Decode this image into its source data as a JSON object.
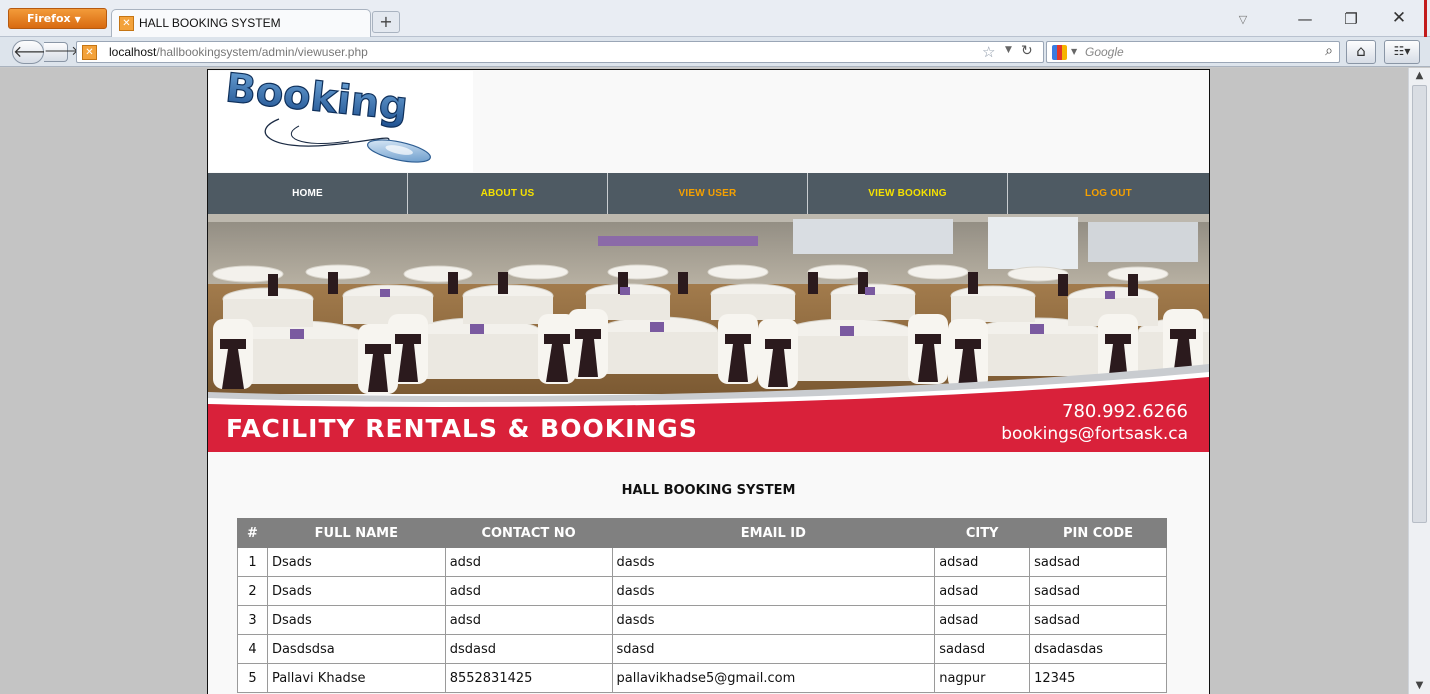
{
  "browser": {
    "menu_button": "Firefox",
    "tab_title": "HALL BOOKING SYSTEM",
    "url_host": "localhost",
    "url_path": "/hallbookingsystem/admin/viewuser.php",
    "search_engine": "Google"
  },
  "logo": {
    "text": "Booking"
  },
  "menu": {
    "items": [
      {
        "label": "HOME",
        "color": "#ffffff"
      },
      {
        "label": "ABOUT US",
        "color": "#f5e100"
      },
      {
        "label": "VIEW USER",
        "color": "#f5a000"
      },
      {
        "label": "VIEW BOOKING",
        "color": "#f5e100"
      },
      {
        "label": "LOG OUT",
        "color": "#f5a000"
      }
    ]
  },
  "banner": {
    "headline": "FACILITY RENTALS & BOOKINGS",
    "phone": "780.992.6266",
    "email": "bookings@fortsask.ca",
    "accent_color": "#d9213a"
  },
  "page": {
    "heading": "HALL BOOKING SYSTEM"
  },
  "table": {
    "headers": [
      "#",
      "FULL NAME",
      "CONTACT NO",
      "EMAIL ID",
      "CITY",
      "PIN CODE"
    ],
    "rows": [
      [
        "1",
        "Dsads",
        "adsd",
        "dasds",
        "adsad",
        "sadsad"
      ],
      [
        "2",
        "Dsads",
        "adsd",
        "dasds",
        "adsad",
        "sadsad"
      ],
      [
        "3",
        "Dsads",
        "adsd",
        "dasds",
        "adsad",
        "sadsad"
      ],
      [
        "4",
        "Dasdsdsa",
        "dsdasd",
        "sdasd",
        "sadasd",
        "dsadasdas"
      ],
      [
        "5",
        "Pallavi Khadse",
        "8552831425",
        "pallavikhadse5@gmail.com",
        "nagpur",
        "12345"
      ]
    ]
  }
}
